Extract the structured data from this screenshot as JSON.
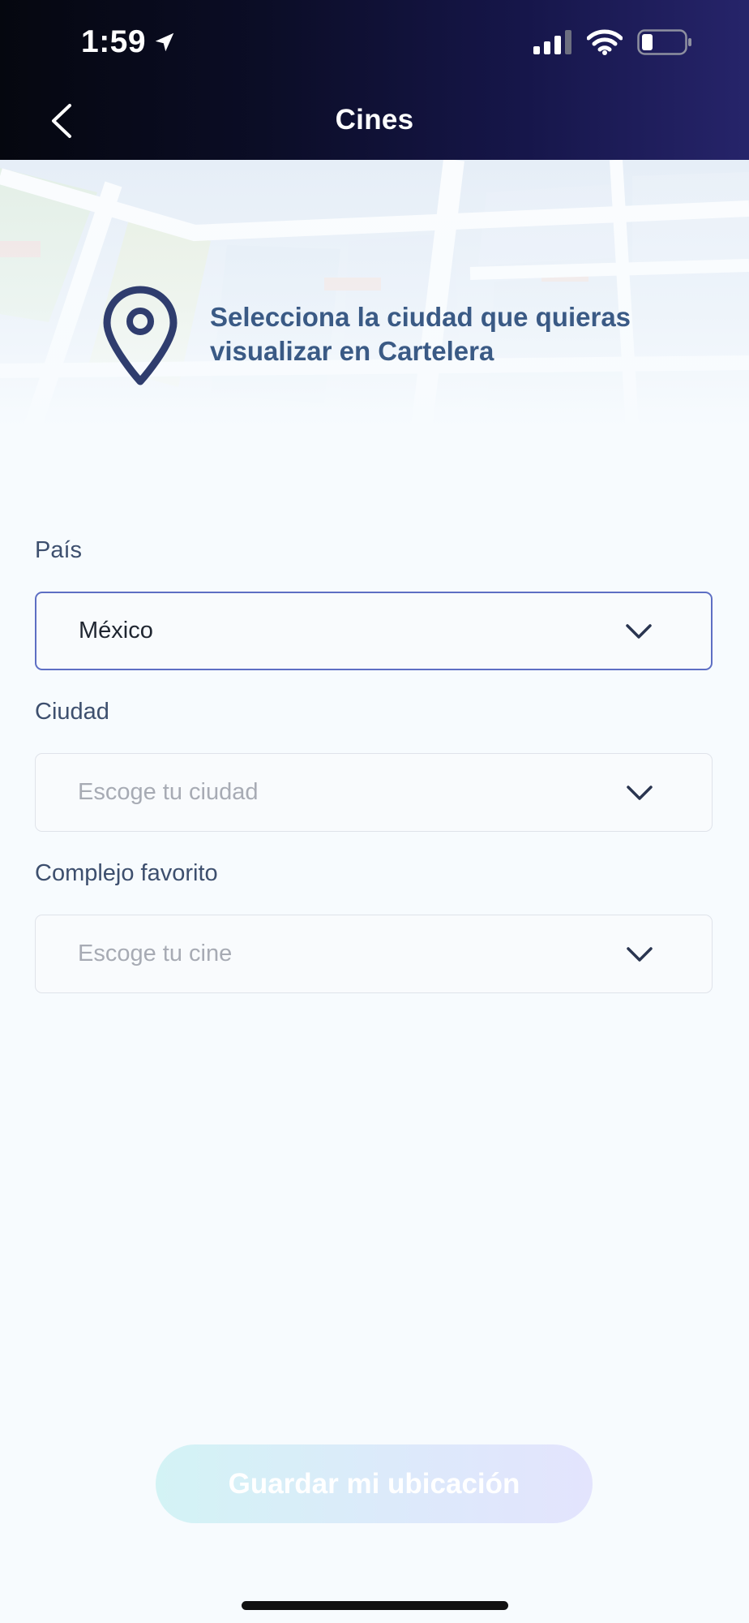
{
  "status_bar": {
    "time": "1:59"
  },
  "header": {
    "title": "Cines"
  },
  "intro": {
    "text": "Selecciona la ciudad que quieras visualizar en Cartelera"
  },
  "form": {
    "country": {
      "label": "País",
      "value": "México"
    },
    "city": {
      "label": "Ciudad",
      "placeholder": "Escoge tu ciudad"
    },
    "cinema": {
      "label": "Complejo favorito",
      "placeholder": "Escoge tu cine"
    }
  },
  "actions": {
    "save_label": "Guardar mi ubicación"
  },
  "colors": {
    "accent": "#5e6fc4",
    "intro_text": "#3a5a85",
    "header_dark": "#05070f",
    "header_light": "#26246a"
  }
}
